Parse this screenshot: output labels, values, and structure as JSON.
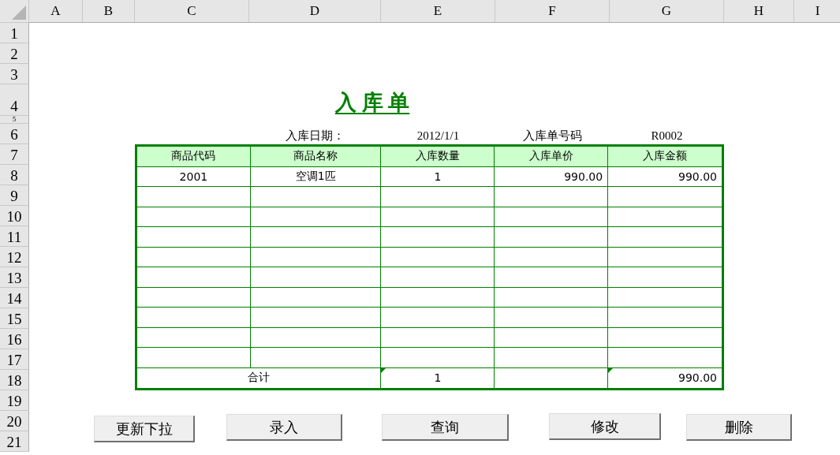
{
  "columns": [
    "A",
    "B",
    "C",
    "D",
    "E",
    "F",
    "G",
    "H",
    "I"
  ],
  "rows": [
    "1",
    "2",
    "3",
    "4",
    "5",
    "6",
    "7",
    "8",
    "9",
    "10",
    "11",
    "12",
    "13",
    "14",
    "15",
    "16",
    "17",
    "18",
    "19",
    "20",
    "21"
  ],
  "title": "入 库 单",
  "info": [
    "入库日期：",
    "2012/1/1",
    "入库单号码",
    "R0002"
  ],
  "table": {
    "columns": [
      "商品代码",
      "商品名称",
      "入库数量",
      "入库单价",
      "入库金额"
    ],
    "rows": [
      {
        "cells": [
          "2001",
          "空调1匹",
          "1",
          "990.00",
          "990.00"
        ]
      }
    ],
    "total": {
      "label": "合计",
      "quantity": "1",
      "amount": "990.00"
    }
  },
  "buttons": [
    "更新下拉",
    "录入",
    "查询",
    "修改",
    "删除"
  ]
}
